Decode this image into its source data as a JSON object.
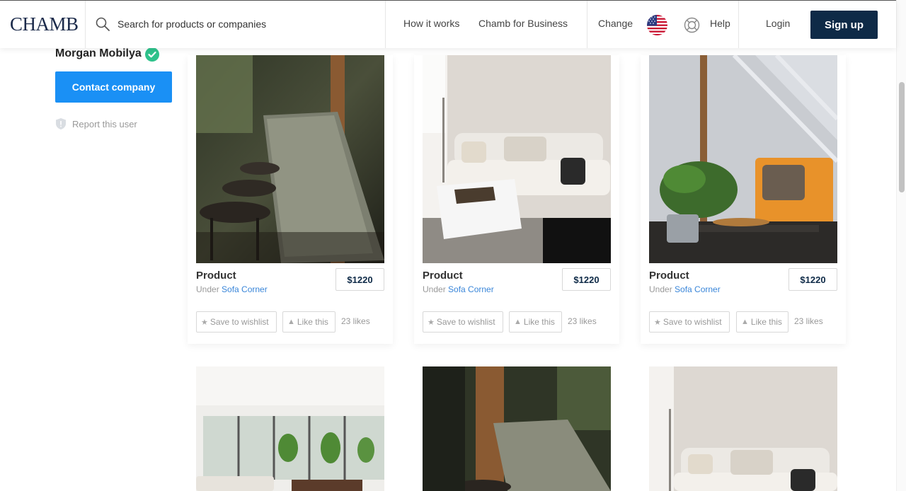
{
  "header": {
    "logo": "CHAMB",
    "search_placeholder": "Search for products or companies",
    "nav": {
      "how_it_works": "How it works",
      "business": "Chamb for Business",
      "change": "Change",
      "help": "Help",
      "login": "Login",
      "signup": "Sign up"
    }
  },
  "sidebar": {
    "company_name": "Morgan Mobilya",
    "contact_button": "Contact company",
    "report_link": "Report this user"
  },
  "products": [
    {
      "title": "Product",
      "under_label": "Under",
      "category": "Sofa Corner",
      "price": "$1220",
      "save_label": "Save to wishlist",
      "like_label": "Like this",
      "likes": "23 likes",
      "image": "outdoor-table"
    },
    {
      "title": "Product",
      "under_label": "Under",
      "category": "Sofa Corner",
      "price": "$1220",
      "save_label": "Save to wishlist",
      "like_label": "Like this",
      "likes": "23 likes",
      "image": "white-sofa"
    },
    {
      "title": "Product",
      "under_label": "Under",
      "category": "Sofa Corner",
      "price": "$1220",
      "save_label": "Save to wishlist",
      "like_label": "Like this",
      "likes": "23 likes",
      "image": "orange-chair"
    },
    {
      "title": "",
      "image": "living-room"
    },
    {
      "title": "",
      "image": "outdoor-table"
    },
    {
      "title": "",
      "image": "white-sofa"
    }
  ],
  "colors": {
    "brand_navy": "#0e2a47",
    "accent_blue": "#1a90f5",
    "link_blue": "#3a86d9",
    "verified_green": "#2ec28b"
  }
}
